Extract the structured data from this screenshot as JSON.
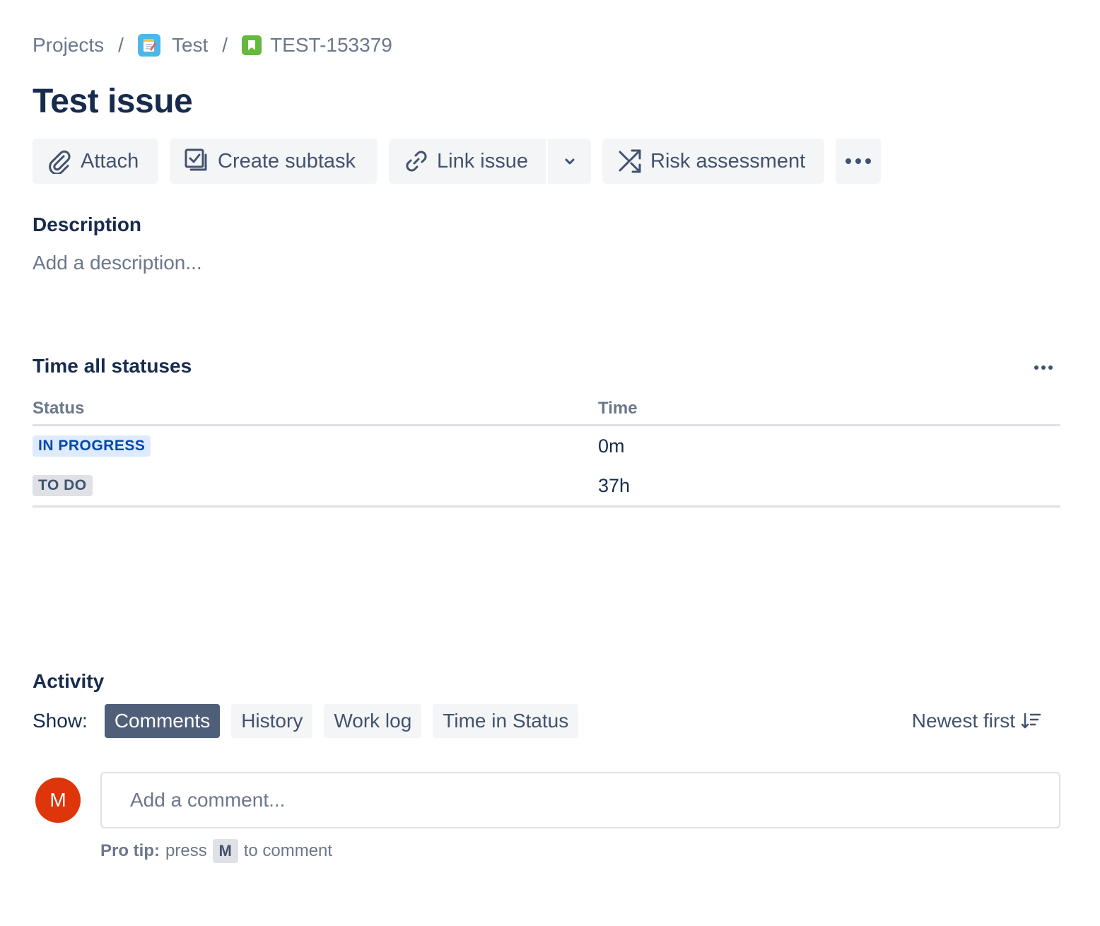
{
  "breadcrumb": {
    "projects": "Projects",
    "separator": "/",
    "project": "Test",
    "issue_key": "TEST-153379"
  },
  "issue": {
    "title": "Test issue"
  },
  "toolbar": {
    "attach": "Attach",
    "create_subtask": "Create subtask",
    "link_issue": "Link issue",
    "risk_assessment": "Risk assessment"
  },
  "description": {
    "heading": "Description",
    "placeholder": "Add a description..."
  },
  "time_all_statuses": {
    "heading": "Time all statuses",
    "columns": [
      "Status",
      "Time"
    ],
    "rows": [
      {
        "status": "IN PROGRESS",
        "time": "0m",
        "color": "#deebff"
      },
      {
        "status": "TO DO",
        "time": "37h",
        "color": "#dfe1e6"
      }
    ]
  },
  "activity": {
    "heading": "Activity",
    "show_label": "Show:",
    "filters": [
      "Comments",
      "History",
      "Work log",
      "Time in Status"
    ],
    "active_filter": "Comments",
    "sort": "Newest first",
    "avatar_initial": "M",
    "comment_placeholder": "Add a comment...",
    "pro_tip": {
      "label": "Pro tip:",
      "press": "press",
      "key": "M",
      "suffix": "to comment"
    }
  },
  "colors": {
    "accent": "#0052cc",
    "avatar": "#de350b",
    "active_filter": "#505f79"
  },
  "icons": {
    "project": "project-notepad-icon",
    "issue_type": "story-icon",
    "attach": "paperclip-icon",
    "create_subtask": "subtask-icon",
    "link_issue": "link-icon",
    "link_dropdown": "chevron-down-icon",
    "risk_assessment": "shuffle-icon",
    "more": "more-icon",
    "sort": "sort-icon"
  }
}
